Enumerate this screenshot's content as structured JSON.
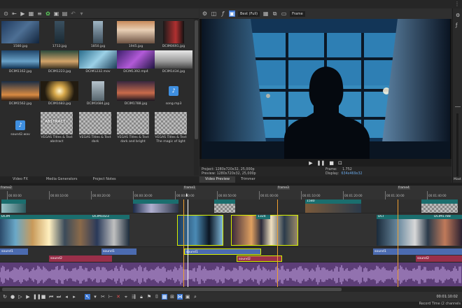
{
  "media_items": [
    {
      "name": "1580.jpg"
    },
    {
      "name": "1713.jpg"
    },
    {
      "name": "1850.jpg"
    },
    {
      "name": "1945.jpg"
    },
    {
      "name": "DCIM0691.jpg"
    },
    {
      "name": "DCIM1162.jpg"
    },
    {
      "name": "DCIM1223.jpg"
    },
    {
      "name": "DCIM1232.mov"
    },
    {
      "name": "DCIM1392.mp4"
    },
    {
      "name": "DCIM1434.jpg"
    },
    {
      "name": "DCIM1562.jpg"
    },
    {
      "name": "DCIM1683.jpg"
    },
    {
      "name": "DCIM1684.jpg"
    },
    {
      "name": "DCIM1788.jpg"
    },
    {
      "name": "song.mp3"
    },
    {
      "name": "sound2.wav"
    },
    {
      "name": "VEGAS Titles & Text abstract"
    },
    {
      "name": "VEGAS Titles & Text dark"
    },
    {
      "name": "VEGAS Titles & Text dark and bright"
    },
    {
      "name": "VEGAS Titles & Text The magic of light"
    }
  ],
  "abstract_label": "ABSTRACT",
  "left_tabs": [
    "Video FX",
    "Media Generators",
    "Project Notes"
  ],
  "preview": {
    "quality": "Best (Full)",
    "frame_field": "Frame",
    "project_label": "Project:",
    "project_value": "1280x720x32, 25,000p",
    "preview_label": "Preview:",
    "preview_value": "1280x720x32, 25,000p",
    "frame_label": "Frame:",
    "frame_value": "1.752",
    "display_label": "Display:",
    "display_value": "634x469x32"
  },
  "preview_tabs": [
    "Video Preview",
    "Trimmer"
  ],
  "master_label": "Mast",
  "ruler_marks": [
    "00:00:00",
    "00:00:10:00",
    "00:00:20:00",
    "00:00:30:00",
    "00:00:40:00",
    "00:00:50:00",
    "00:01:00:00",
    "00:01:10:00",
    "00:01:20:00",
    "00:01:30:00",
    "00:01:40:00"
  ],
  "markers": [
    "frame2",
    "frame1",
    "frame3",
    "frame4"
  ],
  "clips": {
    "top": [
      "DCIM",
      "1580"
    ],
    "main": [
      "DCIM",
      "DCIM1023",
      "1324",
      "DCI",
      "DCIM1788"
    ]
  },
  "audio": {
    "sound1": "sound1",
    "sound2": "sound2"
  },
  "time_readout": "00:01:10:02",
  "status": "Record Time (2 channels"
}
